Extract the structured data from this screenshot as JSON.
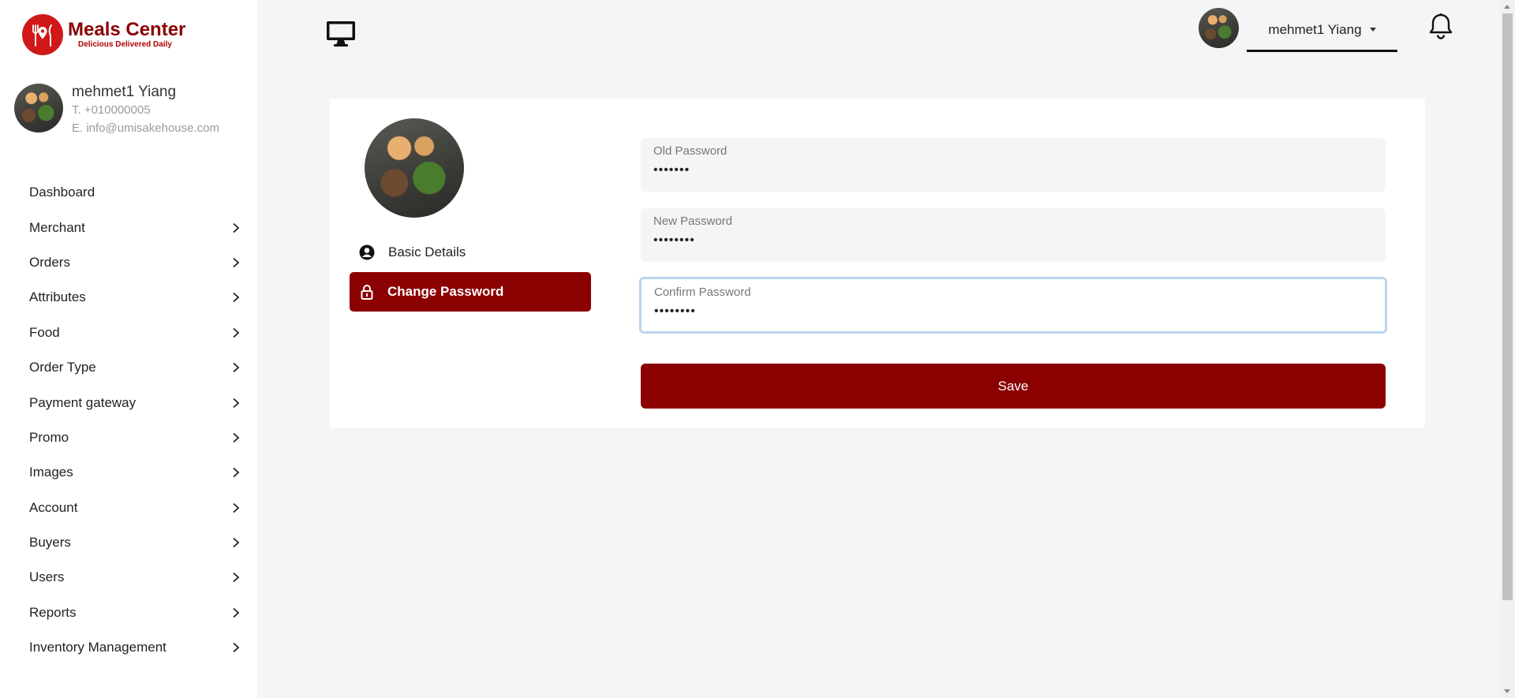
{
  "brand": {
    "name": "Meals Center",
    "tagline": "Delicious Delivered Daily"
  },
  "profile": {
    "name": "mehmet1 Yiang",
    "phone": "T. +010000005",
    "email": "E. info@umisakehouse.com"
  },
  "sidebar": {
    "items": [
      {
        "label": "Dashboard",
        "has_submenu": false
      },
      {
        "label": "Merchant",
        "has_submenu": true
      },
      {
        "label": "Orders",
        "has_submenu": true
      },
      {
        "label": "Attributes",
        "has_submenu": true
      },
      {
        "label": "Food",
        "has_submenu": true
      },
      {
        "label": "Order Type",
        "has_submenu": true
      },
      {
        "label": "Payment gateway",
        "has_submenu": true
      },
      {
        "label": "Promo",
        "has_submenu": true
      },
      {
        "label": "Images",
        "has_submenu": true
      },
      {
        "label": "Account",
        "has_submenu": true
      },
      {
        "label": "Buyers",
        "has_submenu": true
      },
      {
        "label": "Users",
        "has_submenu": true
      },
      {
        "label": "Reports",
        "has_submenu": true
      },
      {
        "label": "Inventory Management",
        "has_submenu": true
      }
    ]
  },
  "header": {
    "user_name": "mehmet1 Yiang"
  },
  "tabs": {
    "basic_details": "Basic Details",
    "change_password": "Change Password"
  },
  "form": {
    "old_password": {
      "label": "Old Password",
      "value": "•••••••"
    },
    "new_password": {
      "label": "New Password",
      "value": "••••••••"
    },
    "confirm_password": {
      "label": "Confirm Password",
      "value": "••••••••"
    },
    "save_label": "Save"
  },
  "colors": {
    "accent": "#8b0000",
    "logo_red": "#d01818",
    "focus_border": "#bcd5ef",
    "background": "#f4f5f7"
  }
}
